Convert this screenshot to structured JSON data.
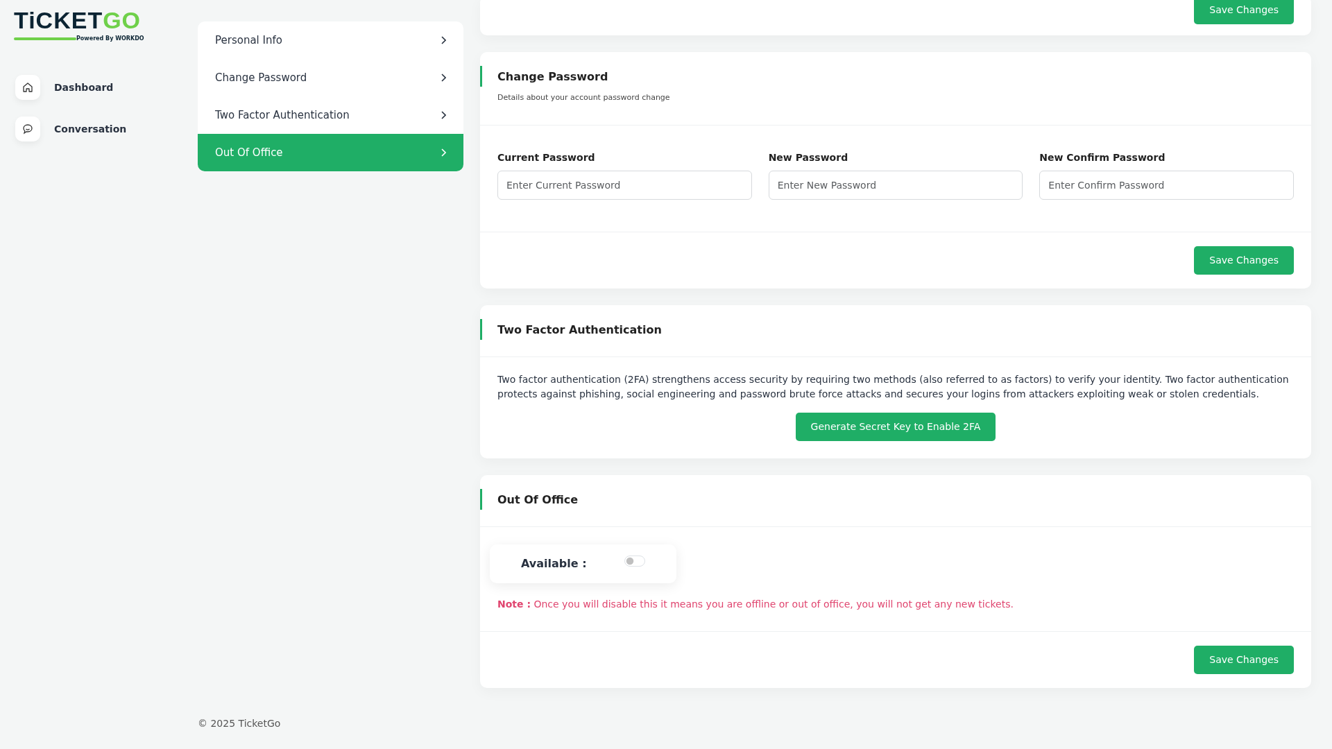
{
  "logo": {
    "name_dark": "TiCKET",
    "name_accent": "GO",
    "tagline": "Powered By",
    "tagline_brand": "WORKDO"
  },
  "sidebar": {
    "items": [
      {
        "label": "Dashboard"
      },
      {
        "label": "Conversation"
      }
    ]
  },
  "settings_menu": {
    "items": [
      {
        "label": "Personal Info",
        "selected": false
      },
      {
        "label": "Change Password",
        "selected": false
      },
      {
        "label": "Two Factor Authentication",
        "selected": false
      },
      {
        "label": "Out Of Office",
        "selected": true
      }
    ]
  },
  "top_card": {
    "button": "Save Changes"
  },
  "change_password": {
    "title": "Change Password",
    "subtitle": "Details about your account password change",
    "fields": [
      {
        "label": "Current Password",
        "placeholder": "Enter Current Password"
      },
      {
        "label": "New Password",
        "placeholder": "Enter New Password"
      },
      {
        "label": "New Confirm Password",
        "placeholder": "Enter Confirm Password"
      }
    ],
    "button": "Save Changes"
  },
  "two_factor": {
    "title": "Two Factor Authentication",
    "description": "Two factor authentication (2FA) strengthens access security by requiring two methods (also referred to as factors) to verify your identity. Two factor authentication protects against phishing, social engineering and password brute force attacks and secures your logins from attackers exploiting weak or stolen credentials.",
    "button": "Generate Secret Key to Enable 2FA"
  },
  "out_of_office": {
    "title": "Out Of Office",
    "toggle": {
      "label": "Available :",
      "on": false
    },
    "note": "**Note :** Once you will disable this it means you are offline or out of office, you will not get any new tickets.",
    "button": "Save Changes"
  },
  "footer": "© 2025 TicketGo"
}
